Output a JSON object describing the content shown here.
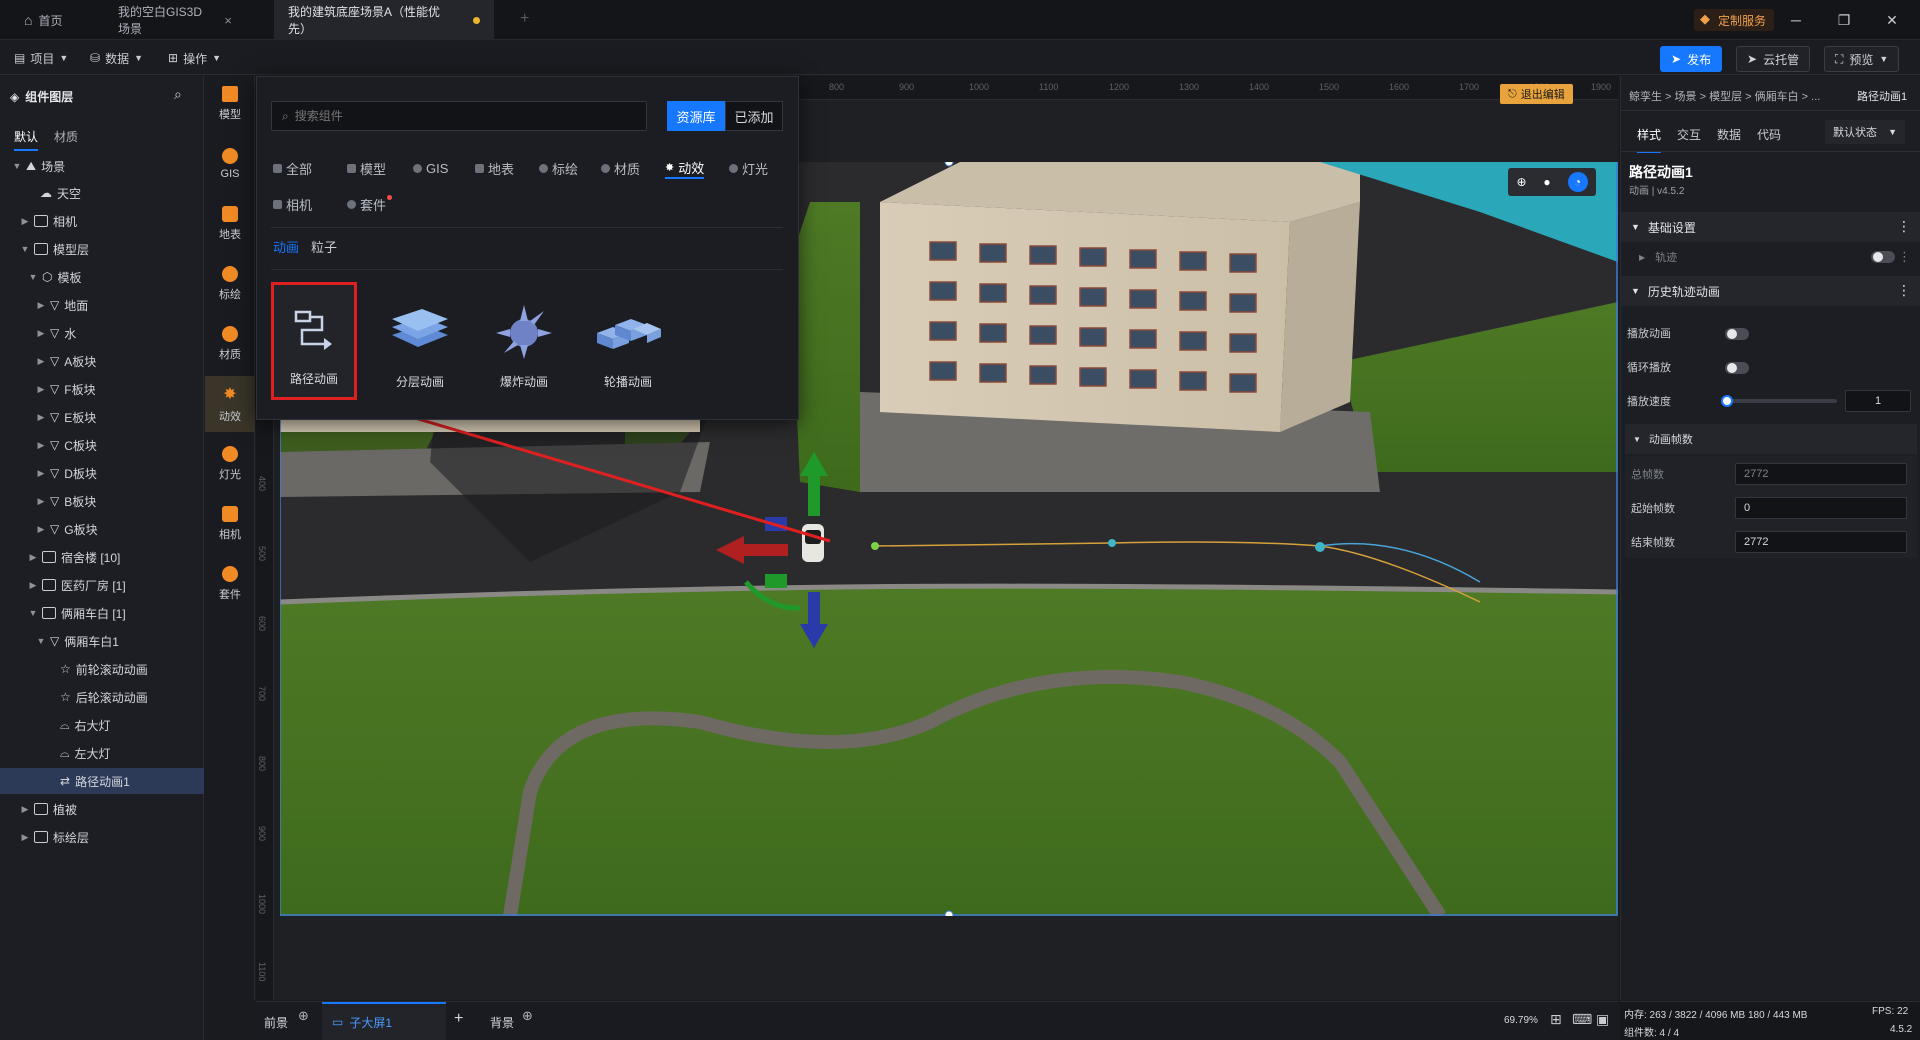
{
  "titlebar": {
    "tabs": [
      {
        "label": "首页"
      },
      {
        "label": "我的空白GIS3D场景"
      },
      {
        "label": "我的建筑底座场景A（性能优先）"
      }
    ],
    "custom_service": "定制服务"
  },
  "menubar": {
    "items": [
      "项目",
      "数据",
      "操作"
    ],
    "publish": "发布",
    "cloud": "云托管",
    "preview": "预览"
  },
  "layers": {
    "title": "组件图层",
    "tabs": [
      "默认",
      "材质"
    ],
    "items": [
      {
        "label": "场景"
      },
      {
        "label": "天空"
      },
      {
        "label": "相机"
      },
      {
        "label": "模型层"
      },
      {
        "label": "模板"
      },
      {
        "label": "地面"
      },
      {
        "label": "水"
      },
      {
        "label": "A板块"
      },
      {
        "label": "F板块"
      },
      {
        "label": "E板块"
      },
      {
        "label": "C板块"
      },
      {
        "label": "D板块"
      },
      {
        "label": "B板块"
      },
      {
        "label": "G板块"
      },
      {
        "label": "宿舍楼 [10]"
      },
      {
        "label": "医药厂房 [1]"
      },
      {
        "label": "俩厢车白 [1]"
      },
      {
        "label": "俩厢车白1"
      },
      {
        "label": "前轮滚动动画"
      },
      {
        "label": "后轮滚动动画"
      },
      {
        "label": "右大灯"
      },
      {
        "label": "左大灯"
      },
      {
        "label": "路径动画1"
      },
      {
        "label": "植被"
      },
      {
        "label": "标绘层"
      }
    ]
  },
  "iconbar": {
    "items": [
      "模型",
      "GIS",
      "地表",
      "标绘",
      "材质",
      "动效",
      "灯光",
      "相机",
      "套件"
    ]
  },
  "popup": {
    "search_placeholder": "搜索组件",
    "lib_tab": "资源库",
    "added_tab": "已添加",
    "categories": [
      "全部",
      "模型",
      "GIS",
      "地表",
      "标绘",
      "材质",
      "动效",
      "灯光",
      "相机",
      "套件"
    ],
    "subtabs": [
      "动画",
      "粒子"
    ],
    "cards": [
      "路径动画",
      "分层动画",
      "爆炸动画",
      "轮播动画"
    ]
  },
  "viewport": {
    "exit_edit": "退出编辑",
    "ruler_top": [
      "800",
      "900",
      "1000",
      "1100",
      "1200",
      "1300",
      "1400",
      "1500",
      "1600",
      "1700",
      "1800",
      "1900"
    ],
    "ruler_left": [
      "400",
      "500",
      "600",
      "700",
      "800",
      "900",
      "1000",
      "1100"
    ]
  },
  "right": {
    "breadcrumb": "鲸孪生 > 场景 > 模型层 > 俩厢车白 > ...",
    "breadcrumb_current": "路径动画1",
    "tabs": [
      "样式",
      "交互",
      "数据",
      "代码"
    ],
    "state_select": "默认状态",
    "comp_name": "路径动画1",
    "comp_meta": "动画 | v4.5.2",
    "sec_basic": "基础设置",
    "track": "轨迹",
    "sec_history": "历史轨迹动画",
    "play": "播放动画",
    "loop": "循环播放",
    "speed": "播放速度",
    "speed_value": "1",
    "speed_level": 0,
    "sec_frames": "动画帧数",
    "total_frames_label": "总帧数",
    "total_frames": "2772",
    "start_frame_label": "起始帧数",
    "start_frame": "0",
    "end_frame_label": "结束帧数",
    "end_frame": "2772"
  },
  "bottom": {
    "foreground": "前景",
    "child_screen": "子大屏1",
    "background": "背景",
    "zoom": "69.79%"
  },
  "status": {
    "memory": "内存: 263 / 3822 / 4096 MB  180 / 443 MB",
    "fps": "FPS: 22",
    "components": "组件数: 4 / 4",
    "version": "4.5.2"
  },
  "colors": {
    "accent": "#1677ff",
    "highlight": "#e02020",
    "orange": "#f08a24"
  }
}
